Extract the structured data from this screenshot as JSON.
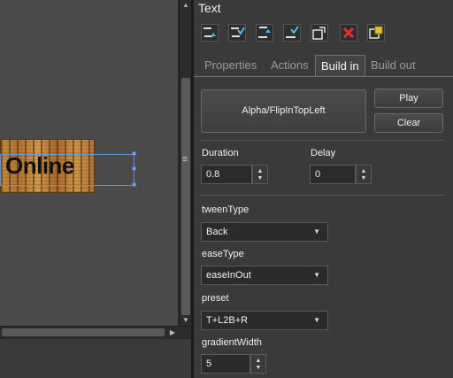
{
  "canvas": {
    "object_text": "Online"
  },
  "panel": {
    "title": "Text",
    "toolbar": [
      {
        "icon": "align-top-up-icon"
      },
      {
        "icon": "align-top-down-icon"
      },
      {
        "icon": "align-bottom-up-icon"
      },
      {
        "icon": "align-bottom-down-icon"
      },
      {
        "icon": "export-icon"
      },
      {
        "icon": "delete-icon"
      },
      {
        "icon": "lock-icon"
      }
    ],
    "tabs": [
      {
        "label": "Properties"
      },
      {
        "label": "Actions"
      },
      {
        "label": "Build in"
      },
      {
        "label": "Build out"
      }
    ],
    "active_tab": "Build in",
    "animation_name": "Alpha/FlipInTopLeft",
    "play_label": "Play",
    "clear_label": "Clear",
    "duration": {
      "label": "Duration",
      "value": "0.8"
    },
    "delay": {
      "label": "Delay",
      "value": "0"
    },
    "tweenType": {
      "label": "tweenType",
      "value": "Back"
    },
    "easeType": {
      "label": "easeType",
      "value": "easeInOut"
    },
    "preset": {
      "label": "preset",
      "value": "T+L2B+R"
    },
    "gradientWidth": {
      "label": "gradientWidth",
      "value": "5"
    }
  },
  "colors": {
    "panel_bg": "#3a3a3a",
    "field_bg": "#2b2b2b",
    "selection": "#6b8fc9"
  }
}
